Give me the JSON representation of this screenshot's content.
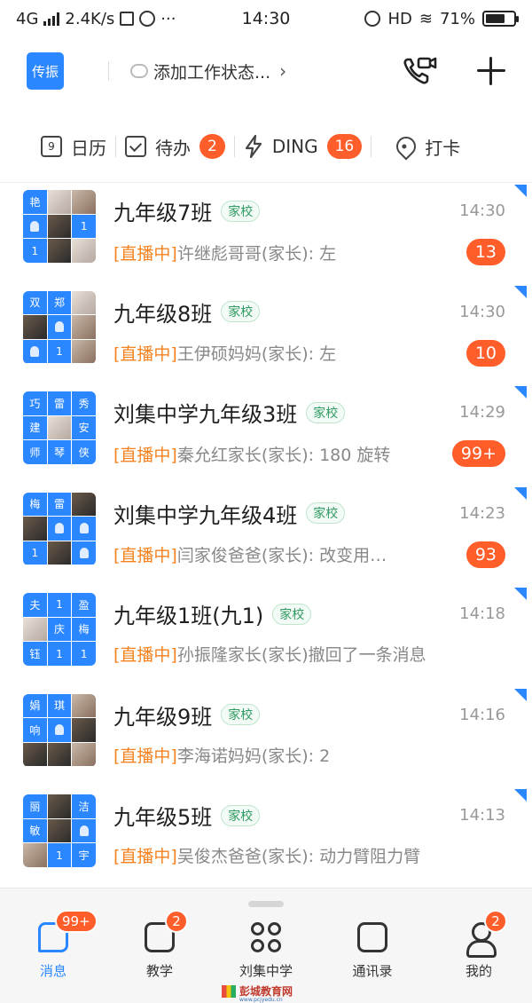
{
  "status_bar": {
    "network": "4G",
    "speed": "2.4K/s",
    "time": "14:30",
    "hd": "HD",
    "battery": "71%",
    "battery_level": 0.71
  },
  "header": {
    "org_name": "传振",
    "work_status": "添加工作状态...",
    "chevron": "›"
  },
  "quick_actions": [
    {
      "label": "日历",
      "icon": "calendar-icon",
      "cal_num": "9"
    },
    {
      "label": "待办",
      "icon": "checkbox-icon",
      "badge": "2"
    },
    {
      "label": "DING",
      "icon": "lightning-icon",
      "badge": "16"
    },
    {
      "label": "打卡",
      "icon": "location-pin-icon"
    }
  ],
  "chats": [
    {
      "name": "九年级7班",
      "tag": "家校",
      "time": "14:30",
      "live": "[直播中]",
      "message": "许继彪哥哥(家长): 左",
      "count": "13",
      "avatar": [
        "艳",
        "photo3",
        "photo2",
        "person",
        "photo",
        "1",
        "1",
        "photo",
        "photo3"
      ]
    },
    {
      "name": "九年级8班",
      "tag": "家校",
      "time": "14:30",
      "live": "[直播中]",
      "message": "王伊硕妈妈(家长): 左",
      "count": "10",
      "avatar": [
        "双",
        "郑",
        "photo3",
        "photo",
        "person",
        "photo2",
        "person",
        "1",
        "photo2"
      ]
    },
    {
      "name": "刘集中学九年级3班",
      "tag": "家校",
      "time": "14:29",
      "live": "[直播中]",
      "message": "秦允红家长(家长): 180 旋转",
      "count": "99+",
      "avatar": [
        "巧",
        "雷",
        "秀",
        "建",
        "photo3",
        "安",
        "师",
        "琴",
        "侠"
      ]
    },
    {
      "name": "刘集中学九年级4班",
      "tag": "家校",
      "time": "14:23",
      "live": "[直播中]",
      "message": "闫家俊爸爸(家长): 改变用…",
      "count": "93",
      "avatar": [
        "梅",
        "雷",
        "photo",
        "photo",
        "person",
        "person",
        "1",
        "photo",
        "person"
      ]
    },
    {
      "name": "九年级1班(九1)",
      "tag": "家校",
      "time": "14:18",
      "live": "[直播中]",
      "message": "孙振隆家长(家长)撤回了一条消息",
      "count": "",
      "avatar": [
        "夫",
        "1",
        "盈",
        "photo3",
        "庆",
        "梅",
        "钰",
        "1",
        "1"
      ]
    },
    {
      "name": "九年级9班",
      "tag": "家校",
      "time": "14:16",
      "live": "[直播中]",
      "message": "李海诺妈妈(家长): 2",
      "count": "",
      "avatar": [
        "娟",
        "琪",
        "photo2",
        "响",
        "person",
        "photo",
        "photo",
        "photo",
        "photo2"
      ]
    },
    {
      "name": "九年级5班",
      "tag": "家校",
      "time": "14:13",
      "live": "[直播中]",
      "message": "吴俊杰爸爸(家长): 动力臂阻力臂",
      "count": "",
      "avatar": [
        "丽",
        "photo",
        "洁",
        "敏",
        "photo",
        "person",
        "photo2",
        "1",
        "宇"
      ]
    }
  ],
  "bottom_nav": [
    {
      "label": "消息",
      "badge": "99+",
      "active": true,
      "icon": "chat-bubble-icon"
    },
    {
      "label": "教学",
      "badge": "2",
      "active": false,
      "icon": "book-icon"
    },
    {
      "label": "刘集中学",
      "badge": "",
      "active": false,
      "icon": "grid-icon"
    },
    {
      "label": "通讯录",
      "badge": "",
      "active": false,
      "icon": "contacts-icon"
    },
    {
      "label": "我的",
      "badge": "2",
      "active": false,
      "icon": "user-icon"
    }
  ],
  "watermark": {
    "name": "彭城教育网",
    "url": "www.pcjyedu.cn"
  },
  "colors": {
    "brand_blue": "#2b87ff",
    "badge_orange": "#ff5e2a",
    "live_orange": "#f5821f",
    "tag_green": "#2f9a62"
  }
}
